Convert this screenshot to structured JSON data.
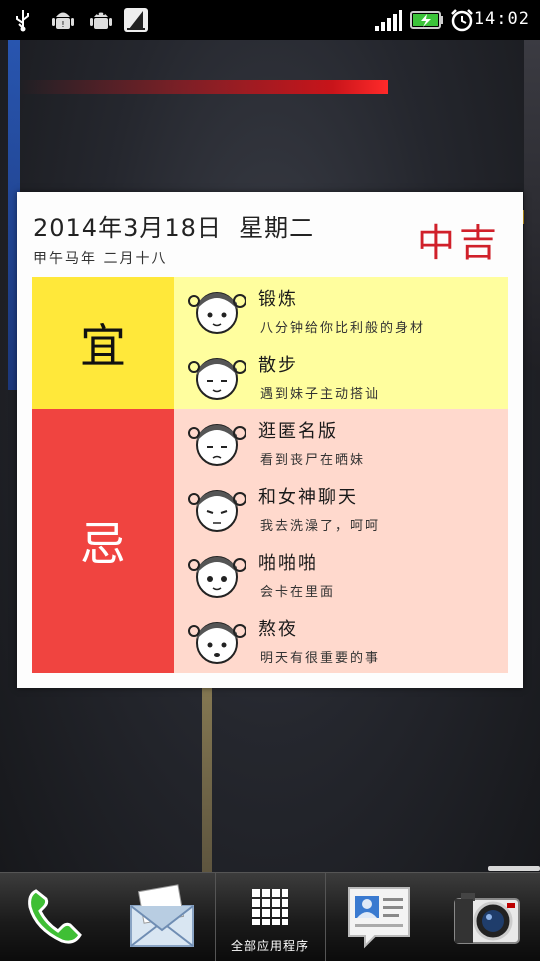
{
  "status_bar": {
    "time": "14:02",
    "icons": [
      "usb-icon",
      "android-debug-icon",
      "android-icon",
      "sail-icon",
      "signal-icon",
      "battery-charging-icon",
      "alarm-icon"
    ]
  },
  "widget": {
    "date": "2014年3月18日  星期二",
    "lunar": "甲午马年 二月十八",
    "luck": "中吉",
    "yi_label": "宜",
    "ji_label": "忌",
    "yi_items": [
      {
        "title": "锻炼",
        "desc": "八分钟给你比利般的身材"
      },
      {
        "title": "散步",
        "desc": "遇到妹子主动搭讪"
      }
    ],
    "ji_items": [
      {
        "title": "逛匿名版",
        "desc": "看到丧尸在晒妹"
      },
      {
        "title": "和女神聊天",
        "desc": "我去洗澡了，呵呵"
      },
      {
        "title": "啪啪啪",
        "desc": "会卡在里面"
      },
      {
        "title": "熬夜",
        "desc": "明天有很重要的事"
      }
    ]
  },
  "dock": {
    "items": [
      "phone-icon",
      "mail-icon",
      "all-apps-icon",
      "people-icon",
      "camera-icon"
    ],
    "all_apps_label": "全部应用程序"
  },
  "colors": {
    "yi_bg": "#ffe83a",
    "yi_items_bg": "#fffe9e",
    "ji_bg": "#f04440",
    "ji_items_bg": "#ffd9cd",
    "luck_color": "#d0202a"
  }
}
